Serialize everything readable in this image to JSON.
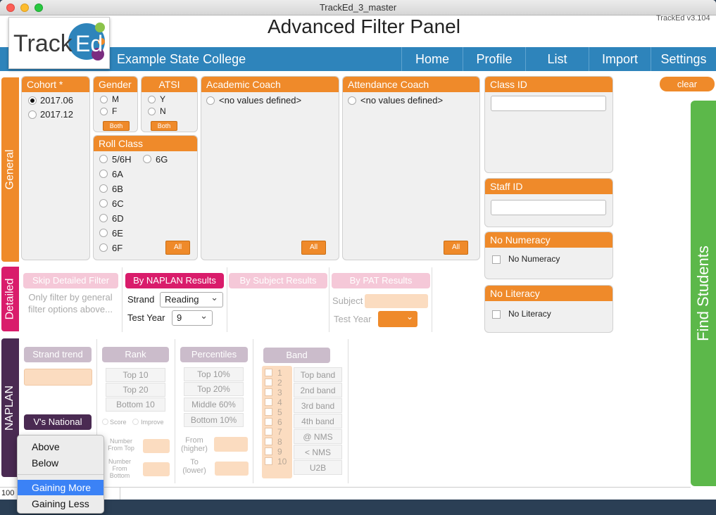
{
  "window": {
    "title": "TrackEd_3_master",
    "version": "TrackEd v3.104"
  },
  "colors": {
    "nav": "#2e84bb",
    "accent": "#ef8a2a",
    "general_tab": "#ef8a2a",
    "detailed_tab": "#d91c6b",
    "naplan_tab": "#4a2a52",
    "find_students": "#5cb84a",
    "selected_menu": "#3b82f6"
  },
  "header": {
    "logo_text": "TrackEd",
    "title": "Advanced Filter Panel",
    "school": "Example State College",
    "nav": [
      "Home",
      "Profile",
      "List",
      "Import",
      "Settings"
    ]
  },
  "side_tabs": {
    "general": "General",
    "detailed": "Detailed",
    "naplan": "NAPLAN"
  },
  "general": {
    "cohort": {
      "title": "Cohort *",
      "options": [
        "2017.06",
        "2017.12"
      ],
      "selected": "2017.06"
    },
    "gender": {
      "title": "Gender",
      "options": [
        "M",
        "F"
      ],
      "both": "Both"
    },
    "atsi": {
      "title": "ATSI",
      "options": [
        "Y",
        "N"
      ],
      "both": "Both"
    },
    "roll_class": {
      "title": "Roll Class",
      "options": [
        "5/6H",
        "6A",
        "6B",
        "6C",
        "6D",
        "6E",
        "6F",
        "6G"
      ],
      "all": "All"
    },
    "academic_coach": {
      "title": "Academic Coach",
      "empty": "<no values defined>",
      "all": "All"
    },
    "attendance_coach": {
      "title": "Attendance Coach",
      "empty": "<no values defined>",
      "all": "All"
    },
    "class_id": {
      "title": "Class ID",
      "value": ""
    },
    "staff_id": {
      "title": "Staff ID",
      "value": ""
    },
    "no_numeracy": {
      "title": "No Numeracy",
      "label": "No Numeracy"
    },
    "no_literacy": {
      "title": "No Literacy",
      "label": "No Literacy"
    },
    "clear": "clear",
    "find": "Find Students"
  },
  "detailed": {
    "skip": "Skip Detailed Filter",
    "skip_note": "Only filter by general filter options above...",
    "naplan_btn": "By NAPLAN Results",
    "subject_btn": "By Subject Results",
    "pat_btn": "By PAT Results",
    "strand_label": "Strand",
    "strand_value": "Reading",
    "test_year_label": "Test Year",
    "test_year_value": "9",
    "subject_label": "Subject",
    "pat_test_year_label": "Test Year"
  },
  "naplan": {
    "strand_trend": "Strand trend",
    "vs_national": "V's National",
    "rank": {
      "title": "Rank",
      "items": [
        "Top 10",
        "Top 20",
        "Bottom 10"
      ],
      "score": "Score",
      "improve": "Improve",
      "from_top": "Number From Top",
      "from_bottom": "Number From Bottom"
    },
    "percentiles": {
      "title": "Percentiles",
      "items": [
        "Top 10%",
        "Top 20%",
        "Middle 60%",
        "Bottom 10%"
      ],
      "from": "From (higher)",
      "to": "To (lower)"
    },
    "band": {
      "title": "Band",
      "numbers": [
        "1",
        "2",
        "3",
        "4",
        "5",
        "6",
        "7",
        "8",
        "9",
        "10"
      ],
      "items": [
        "Top band",
        "2nd band",
        "3rd band",
        "4th band",
        "@ NMS",
        "< NMS",
        "U2B"
      ]
    }
  },
  "popup_menu": {
    "items": [
      "Above",
      "Below",
      "Gaining More",
      "Gaining Less"
    ],
    "selected": "Gaining More"
  },
  "status": {
    "zoom": "100"
  }
}
